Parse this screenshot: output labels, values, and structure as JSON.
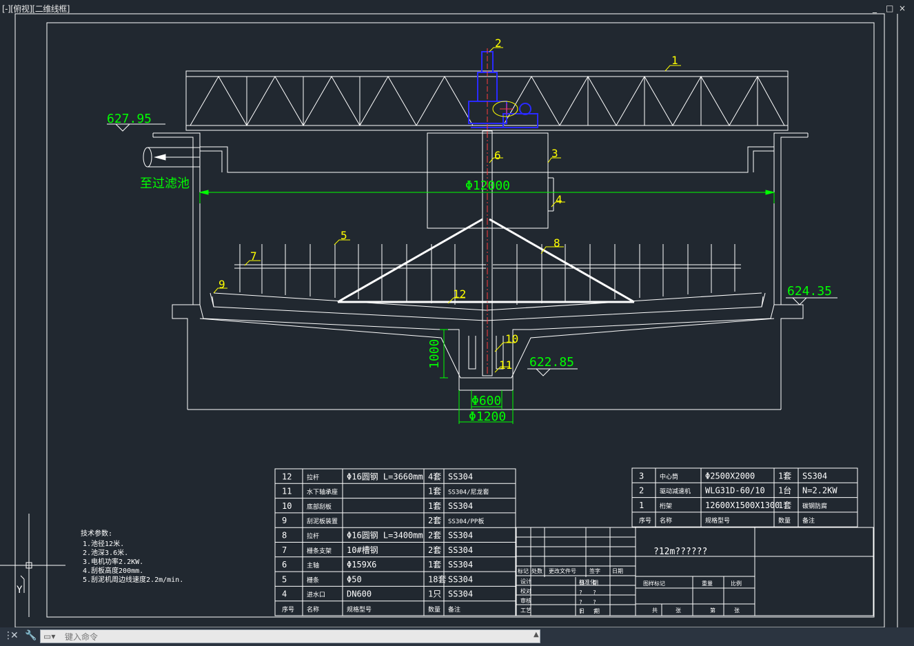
{
  "viewport": {
    "label": "[-][俯视][二维线框]"
  },
  "window_controls": {
    "minimize": "_",
    "restore": "□",
    "close": "×"
  },
  "drawing": {
    "elev_top": "627.95",
    "elev_right": "624.35",
    "elev_bottom": "622.85",
    "outlet_label": "至过滤池",
    "diameter_main": "Φ12000",
    "dim_depth": "1000",
    "dim_600": "Φ600",
    "dim_1200": "Φ1200",
    "balloons": [
      "1",
      "2",
      "3",
      "4",
      "5",
      "6",
      "7",
      "8",
      "9",
      "10",
      "11",
      "12"
    ]
  },
  "tech": {
    "title": "技术参数:",
    "lines": [
      "1.池径12米.",
      "2.池深3.6米.",
      "3.电机功率2.2KW.",
      "4.刮板高度200mm.",
      "5.刮泥机周边线速度2.2m/min."
    ]
  },
  "bom_left": {
    "rows": [
      [
        "12",
        "拉杆",
        "Φ16圆钢 L=3660mm",
        "4套",
        "SS304"
      ],
      [
        "11",
        "水下轴承座",
        "",
        "1套",
        "SS304/尼龙套"
      ],
      [
        "10",
        "底部刮板",
        "",
        "1套",
        "SS304"
      ],
      [
        "9",
        "刮泥板装置",
        "",
        "2套",
        "SS304/PP板"
      ],
      [
        "8",
        "拉杆",
        "Φ16圆钢 L=3400mm",
        "2套",
        "SS304"
      ],
      [
        "7",
        "栅条支架",
        "10#槽钢",
        "2套",
        "SS304"
      ],
      [
        "6",
        "主轴",
        "Φ159X6",
        "1套",
        "SS304"
      ],
      [
        "5",
        "栅条",
        "Φ50",
        "18套",
        "SS304"
      ],
      [
        "4",
        "进水口",
        "DN600",
        "1只",
        "SS304"
      ]
    ],
    "header": [
      "序号",
      "名称",
      "规格型号",
      "数量",
      "备注"
    ]
  },
  "bom_right": {
    "rows": [
      [
        "3",
        "中心筒",
        "Φ2500X2000",
        "1套",
        "SS304"
      ],
      [
        "2",
        "驱动减速机",
        "WLG31D-60/10",
        "1台",
        "N=2.2KW"
      ],
      [
        "1",
        "桁架",
        "12600X1500X1300",
        "1套",
        "碳钢防腐"
      ]
    ],
    "header": [
      "序号",
      "名称",
      "规格型号",
      "数量",
      "备注"
    ]
  },
  "title_block": {
    "drawing_name": "?12m??????",
    "rev_header": [
      "标记",
      "处数",
      "更改文件号",
      "签字",
      "日期"
    ],
    "sign_rows": [
      [
        "设计",
        "",
        "?",
        "?"
      ],
      [
        "校对",
        "",
        "?",
        "?"
      ],
      [
        "审核",
        "",
        "?",
        "?"
      ],
      [
        "工艺",
        "",
        "日",
        "期"
      ]
    ],
    "sign_labels": [
      "标准化"
    ],
    "stage_header": [
      "图样标记",
      "重量",
      "比例"
    ],
    "sheet": [
      "共",
      "张",
      "第",
      "张"
    ]
  },
  "ucs": {
    "y_label": "Y"
  },
  "command": {
    "placeholder": "键入命令"
  },
  "colors": {
    "bg": "#212830",
    "line": "#ffffff",
    "dim": "#00ff00",
    "label": "#ffff00",
    "drive": "#0000ff"
  }
}
